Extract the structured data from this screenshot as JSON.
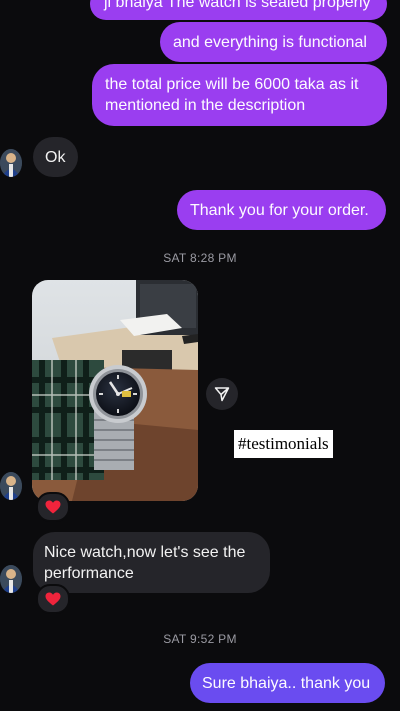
{
  "messages": {
    "m1": "ji bhaiya The watch is sealed properly",
    "m2": "and everything is functional",
    "m3_line1": "the total price will be 6000 taka as it",
    "m3_line2": "mentioned in the description",
    "m4": "Ok",
    "m5": "Thank you for your order.",
    "m6_line1": "Nice watch,now let's see the",
    "m6_line2": "performance",
    "m7": "Sure bhaiya.. thank you"
  },
  "timestamps": {
    "t1": "SAT 8:28 PM",
    "t2": "SAT 9:52 PM"
  },
  "sticker": {
    "text": "#testimonials"
  },
  "reactions": {
    "photo_reaction": "❤️",
    "message_reaction": "❤️"
  },
  "icons": {
    "share": "send-arrow-icon",
    "avatar": "user-avatar-icon"
  },
  "colors": {
    "background": "#0b0b0d",
    "outgoing_bubble": "#9a3ef0",
    "outgoing_bubble_last": "#6a4cf0",
    "incoming_bubble": "#25252a",
    "timestamp_text": "#9b9ba3"
  }
}
